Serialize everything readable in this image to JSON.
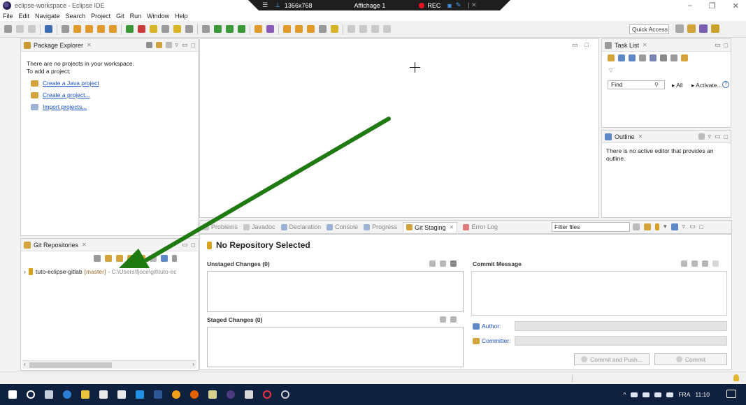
{
  "window": {
    "title": "eclipse-workspace - Eclipse IDE"
  },
  "recorder": {
    "resolution": "1366x768",
    "display": "Affichage 1",
    "rec_label": "REC"
  },
  "menu": [
    "File",
    "Edit",
    "Navigate",
    "Search",
    "Project",
    "Git",
    "Run",
    "Window",
    "Help"
  ],
  "toolbar": {
    "quick_access": "Quick Access"
  },
  "package_explorer": {
    "tab": "Package Explorer",
    "message_line1": "There are no projects in your workspace.",
    "message_line2": "To add a project:",
    "links": [
      "Create a Java project",
      "Create a project...",
      "Import projects..."
    ]
  },
  "task_list": {
    "tab": "Task List",
    "find_placeholder": "Find",
    "all": "All",
    "activate": "Activate...",
    "help": "?"
  },
  "outline": {
    "tab": "Outline",
    "message": "There is no active editor that provides an outline."
  },
  "bottom_tabs": [
    "Problems",
    "Javadoc",
    "Declaration",
    "Console",
    "Progress",
    "Git Staging",
    "Error Log"
  ],
  "filter_files": "Filter files",
  "git_staging": {
    "title": "No Repository Selected",
    "unstaged": "Unstaged Changes (0)",
    "staged": "Staged Changes (0)",
    "commit_message": "Commit Message",
    "author": "Author:",
    "committer": "Committer:",
    "commit_and_push": "Commit and Push...",
    "commit": "Commit"
  },
  "git_repos": {
    "tab": "Git Repositories",
    "repo_name": "tuto-eclipse-gitlab",
    "branch": "[master]",
    "path": "- C:\\Users\\fjoce\\git\\tuto-ec"
  },
  "taskbar": {
    "lang": "FRA",
    "time": "11:10"
  },
  "colors": {
    "arrow": "#1f7a12",
    "accent_link": "#1a4fc4",
    "taskbar": "#10213f"
  },
  "icons": {
    "close_tab": "close-x-icon",
    "minimize": "minimize-icon",
    "maximize": "maximize-icon",
    "repo": "git-repo-icon",
    "bulb": "lightbulb-icon"
  }
}
